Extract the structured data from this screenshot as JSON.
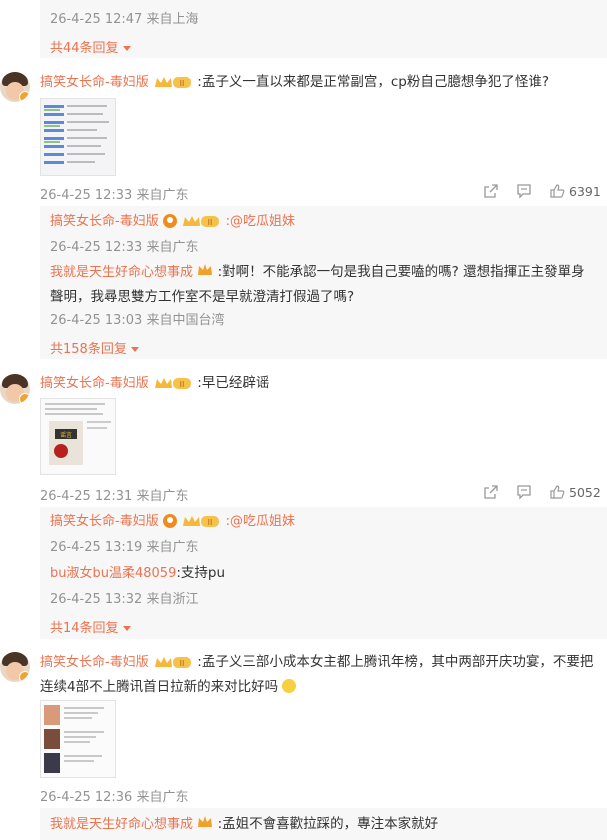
{
  "top": {
    "time": "26-4-25 12:47 来自上海",
    "more": "共44条回复"
  },
  "c1": {
    "user": "搞笑女长命-毒妇版",
    "text": ":孟子义一直以来都是正常副宫，cp粉自己臆想争犯了怪谁?",
    "time": "26-4-25 12:33 来自广东",
    "likes": "6391",
    "r1": {
      "user": "搞笑女长命-毒妇版",
      "mention": ":@吃瓜姐妹",
      "time": "26-4-25 12:33 来自广东"
    },
    "r2": {
      "user": "我就是天生好命心想事成",
      "text": ":對啊！不能承認一句是我自己要嗑的嗎? 還想指揮正主發單身聲明，我尋思雙方工作室不是早就澄清打假過了嗎?",
      "time": "26-4-25 13:03 来自中国台湾"
    },
    "more": "共158条回复"
  },
  "c2": {
    "user": "搞笑女长命-毒妇版",
    "text": ":早已经辟谣",
    "time": "26-4-25 12:31 来自广东",
    "likes": "5052",
    "r1": {
      "user": "搞笑女长命-毒妇版",
      "mention": ":@吃瓜姐妹",
      "time": "26-4-25 13:19 来自广东"
    },
    "r2": {
      "user": "bu淑女bu温柔48059",
      "text": ":支持pu",
      "time": "26-4-25 13:32 来自浙江"
    },
    "more": "共14条回复"
  },
  "c3": {
    "user": "搞笑女长命-毒妇版",
    "text": ":孟子义三部小成本女主都上腾讯年榜，其中两部开庆功宴，不要把连续4部不上腾讯首日拉新的来对比好吗",
    "time": "26-4-25 12:36 来自广东",
    "r1": {
      "user": "我就是天生好命心想事成",
      "text": ":孟姐不會喜歡拉踩的，專注本家就好"
    }
  },
  "colors": {
    "accent": "#eb7350",
    "meta": "#939393",
    "reply_bg": "#f7f7f7"
  }
}
